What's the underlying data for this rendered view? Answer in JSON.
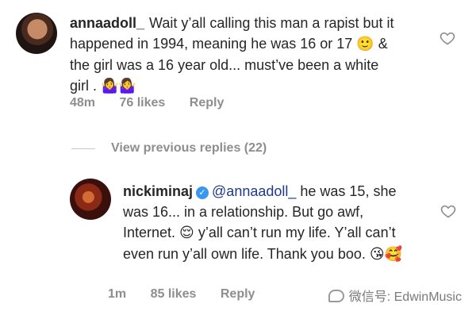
{
  "comments": [
    {
      "username": "annaadoll_",
      "text_parts": [
        "Wait y’all calling this man a rapist but it happened in 1994, meaning he was 16 or 17 ",
        "🙂",
        " & the girl was a 16 year old... must’ve been a white girl . ",
        "🤷‍♀️🤷‍♀️"
      ],
      "age": "48m",
      "likes": "76 likes",
      "reply": "Reply"
    },
    {
      "username": "nickiminaj",
      "verified": true,
      "mention": "@annaadoll_",
      "text_parts": [
        " he was 15, she was 16... in a relationship. But go awf, Internet. ",
        "😌",
        " y’all can’t run my life. Y’all can’t even run y’all own life. Thank you boo. ",
        "😘🥰"
      ],
      "age": "1m",
      "likes": "85 likes",
      "reply": "Reply"
    }
  ],
  "view_previous": "View previous replies (22)",
  "watermark": "微信号: EdwinMusic",
  "icons": {
    "heart": "heart-outline-icon",
    "verified": "verified-badge-icon"
  },
  "colors": {
    "meta": "#8e8e8e",
    "verified": "#3897f0",
    "mention": "#1e3a8a"
  }
}
